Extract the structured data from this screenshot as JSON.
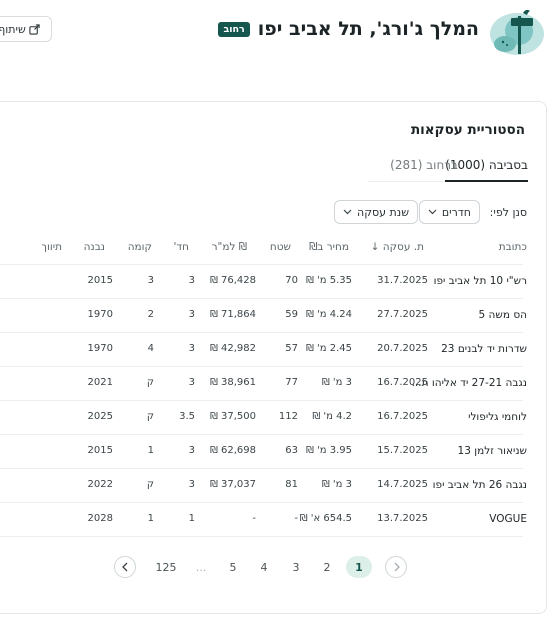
{
  "header": {
    "title": "המלך ג'ורג', תל אביב יפו",
    "badge": "רחוב",
    "share_label": "שיתוף"
  },
  "card": {
    "title": "הסטוריית עסקאות",
    "tabs": [
      {
        "label": "בסביבה (1000)",
        "active": true
      },
      {
        "label": "ברחוב (281)",
        "active": false
      }
    ],
    "filter_label": "סנן לפי:",
    "filters": [
      "חדרים",
      "שנת עסקה"
    ]
  },
  "table": {
    "headers": {
      "address": "כתובת",
      "date": "ת. עסקה ↓",
      "price": "מחיר ב₪",
      "area": "שטח",
      "per_sqm": "₪ למ\"ר",
      "rooms": "חד'",
      "floor": "קומה",
      "built": "נבנה",
      "renovation": "תיווך"
    },
    "rows": [
      {
        "address": "רש\"י 10 תל אביב יפו",
        "date": "31.7.2025",
        "price": "5.35 מ' ₪",
        "area": "70",
        "per_sqm": "76,428 ₪",
        "rooms": "3",
        "floor": "3",
        "built": "2015"
      },
      {
        "address": "הס משה 5",
        "date": "27.7.2025",
        "price": "4.24 מ' ₪",
        "area": "59",
        "per_sqm": "71,864 ₪",
        "rooms": "3",
        "floor": "2",
        "built": "1970"
      },
      {
        "address": "שדרות יד לבנים 23",
        "date": "20.7.2025",
        "price": "2.45 מ' ₪",
        "area": "57",
        "per_sqm": "42,982 ₪",
        "rooms": "3",
        "floor": "4",
        "built": "1970"
      },
      {
        "address": "נגבה 27-21 יד אליהו ת...",
        "date": "16.7.2025",
        "price": "3 מ' ₪",
        "area": "77",
        "per_sqm": "38,961 ₪",
        "rooms": "3",
        "floor": "ק",
        "built": "2021"
      },
      {
        "address": "לוחמי גליפולי",
        "date": "16.7.2025",
        "price": "4.2 מ' ₪",
        "area": "112",
        "per_sqm": "37,500 ₪",
        "rooms": "3.5",
        "floor": "ק",
        "built": "2025"
      },
      {
        "address": "שניאור זלמן 13",
        "date": "15.7.2025",
        "price": "3.95 מ' ₪",
        "area": "63",
        "per_sqm": "62,698 ₪",
        "rooms": "3",
        "floor": "1",
        "built": "2015"
      },
      {
        "address": "נגבה 26 תל אביב יפו",
        "date": "14.7.2025",
        "price": "3 מ' ₪",
        "area": "81",
        "per_sqm": "37,037 ₪",
        "rooms": "3",
        "floor": "ק",
        "built": "2022"
      },
      {
        "address": "VOGUE",
        "date": "13.7.2025",
        "price": "654.5 א' ₪",
        "area": "-",
        "per_sqm": "-",
        "rooms": "1",
        "floor": "1",
        "built": "2028"
      }
    ]
  },
  "pagination": {
    "pages": [
      "1",
      "2",
      "3",
      "4",
      "5",
      "...",
      "125"
    ],
    "current": "1"
  },
  "icons": {
    "share": "share-icon",
    "chevron": "chevron-down-icon",
    "prev": "chevron-right-icon",
    "next": "chevron-left-icon"
  },
  "colors": {
    "brand": "#15564f",
    "active_page_bg": "#dcefe9",
    "logo_teal": "#7ec5c3"
  }
}
